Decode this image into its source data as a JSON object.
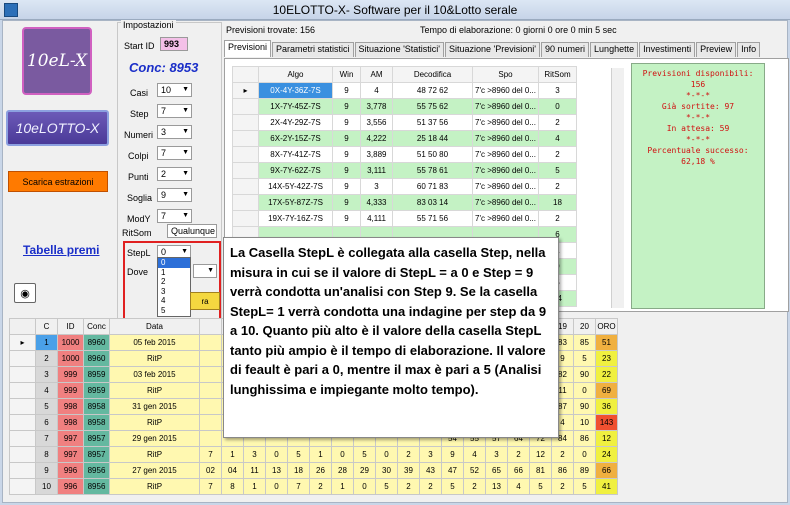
{
  "window": {
    "title": "10ELOTTO-X- Software per il 10&Lotto  serale"
  },
  "logos": {
    "logo_small": "10eL-X",
    "logo_wide": "10eLOTTO-X"
  },
  "left": {
    "download_label": "Scarica estrazioni",
    "prize_link": "Tabella premi"
  },
  "settings": {
    "group_title": "Impostazioni",
    "start_id_label": "Start ID",
    "start_id_value": "993",
    "conc": "Conc: 8953",
    "casi_label": "Casi",
    "casi_value": "10",
    "step_label": "Step",
    "step_value": "7",
    "numeri_label": "Numeri",
    "numeri_value": "3",
    "colpi_label": "Colpi",
    "colpi_value": "7",
    "punti_label": "Punti",
    "punti_value": "2",
    "soglia_label": "Soglia",
    "soglia_value": "9",
    "mody_label": "ModY",
    "mody_value": "7",
    "ritsom_label": "RitSom",
    "ritsom_value": "Qualunque",
    "stepl_label": "StepL",
    "stepl_value": "0",
    "dove_label": "Dove",
    "start_btn": "ra"
  },
  "stepl_options": [
    "0",
    "1",
    "2",
    "3",
    "4",
    "5"
  ],
  "header": {
    "previsioni_trovate": "Previsioni trovate: 156",
    "tempo": "Tempo di elaborazione: 0 giorni 0 ore 0 min 5 sec"
  },
  "tabs": [
    "Previsioni",
    "Parametri statistici",
    "Situazione 'Statistici'",
    "Situazione 'Previsioni'",
    "90 numeri",
    "Lunghette",
    "Investimenti",
    "Preview",
    "Info"
  ],
  "prev_table": {
    "headers": [
      "Algo",
      "Win",
      "AM",
      "Decodifica",
      "Spo",
      "RitSom"
    ],
    "rows": [
      [
        "0X-4Y-36Z-7S",
        "9",
        "4",
        "48 72 62",
        "7'c >8960 del 0...",
        "3"
      ],
      [
        "1X-7Y-45Z-7S",
        "9",
        "3,778",
        "55 75 62",
        "7'c >8960 del 0...",
        "0"
      ],
      [
        "2X-4Y-29Z-7S",
        "9",
        "3,556",
        "51 37 56",
        "7'c >8960 del 0...",
        "2"
      ],
      [
        "6X-2Y-15Z-7S",
        "9",
        "4,222",
        "25 18 44",
        "7'c >8960 del 0...",
        "4"
      ],
      [
        "8X-7Y-41Z-7S",
        "9",
        "3,889",
        "51 50 80",
        "7'c >8960 del 0...",
        "2"
      ],
      [
        "9X-7Y-62Z-7S",
        "9",
        "3,111",
        "55 78 61",
        "7'c >8960 del 0...",
        "5"
      ],
      [
        "14X-5Y-42Z-7S",
        "9",
        "3",
        "60 71 83",
        "7'c >8960 del 0...",
        "2"
      ],
      [
        "17X-5Y-87Z-7S",
        "9",
        "4,333",
        "83 03 14",
        "7'c >8960 del 0...",
        "18"
      ],
      [
        "19X-7Y-16Z-7S",
        "9",
        "4,111",
        "55 71 56",
        "7'c >8960 del 0...",
        "2"
      ],
      [
        "",
        "",
        "",
        "",
        "",
        "6"
      ],
      [
        "",
        "",
        "",
        "",
        "",
        "1"
      ],
      [
        "",
        "",
        "",
        "",
        "",
        "9"
      ],
      [
        "",
        "",
        "",
        "",
        "",
        "5"
      ],
      [
        "",
        "",
        "",
        "",
        "",
        "14"
      ]
    ]
  },
  "info": {
    "l1": "Previsioni disponibili:",
    "l2": "156",
    "sep": "*-*-*",
    "l3": "Già sortite: 97",
    "l4": "In attesa: 59",
    "l5": "Percentuale successo:",
    "l6": "62,18 %"
  },
  "callout": {
    "text": "La Casella StepL è collegata alla casella Step, nella misura in cui se il valore di StepL = a 0 e Step = 9 verrà condotta un'analisi con Step 9. Se la casella StepL= 1 verrà condotta una indagine per step da 9 a 10. Quanto più alto è il valore della casella StepL tanto più ampio è il tempo di elaborazione. Il valore di feault è pari a 0, mentre il max è pari a 5 (Analisi lunghissima e impiegante molto tempo)."
  },
  "draw_table": {
    "headers_left": [
      "C",
      "ID",
      "Conc",
      "Data"
    ],
    "headers_right": [
      "14",
      "15",
      "16",
      "17",
      "18",
      "19",
      "20",
      "ORO"
    ],
    "rows": [
      {
        "c": "1",
        "id": "1000",
        "conc": "8960",
        "data": "05 feb 2015",
        "mid": [
          "",
          "",
          "",
          "",
          "",
          "",
          "",
          "",
          "",
          "",
          ""
        ],
        "right": [
          "67",
          "69",
          "70",
          "75",
          "78",
          "83",
          "85"
        ],
        "oro": "51"
      },
      {
        "c": "2",
        "id": "1000",
        "conc": "8960",
        "data": "RitP",
        "mid": [
          "",
          "",
          "",
          "",
          "",
          "",
          "",
          "",
          "",
          "",
          ""
        ],
        "right": [
          "12",
          "4",
          "5",
          "4",
          "8",
          "9",
          "5"
        ],
        "oro": "23"
      },
      {
        "c": "3",
        "id": "999",
        "conc": "8959",
        "data": "03 feb 2015",
        "mid": [
          "",
          "",
          "",
          "",
          "",
          "",
          "",
          "",
          "",
          "",
          ""
        ],
        "right": [
          "52",
          "54",
          "55",
          "59",
          "68",
          "82",
          "90"
        ],
        "oro": "22"
      },
      {
        "c": "4",
        "id": "999",
        "conc": "8959",
        "data": "RitP",
        "mid": [
          "",
          "",
          "",
          "",
          "",
          "",
          "",
          "",
          "",
          "",
          ""
        ],
        "right": [
          "0",
          "1",
          "1",
          "3",
          "9",
          "11",
          "0"
        ],
        "oro": "69"
      },
      {
        "c": "5",
        "id": "998",
        "conc": "8958",
        "data": "31 gen 2015",
        "mid": [
          "",
          "",
          "",
          "",
          "",
          "",
          "",
          "",
          "",
          "",
          ""
        ],
        "right": [
          "52",
          "71",
          "73",
          "80",
          "83",
          "87",
          "90"
        ],
        "oro": "36"
      },
      {
        "c": "6",
        "id": "998",
        "conc": "8958",
        "data": "RitP",
        "mid": [
          "",
          "",
          "",
          "",
          "",
          "",
          "",
          "",
          "",
          "",
          ""
        ],
        "right": [
          "1",
          "3",
          "2",
          "4",
          "0",
          "4",
          "10"
        ],
        "oro": "143"
      },
      {
        "c": "7",
        "id": "997",
        "conc": "8957",
        "data": "29 gen 2015",
        "mid": [
          "",
          "",
          "",
          "",
          "",
          "",
          "",
          "",
          "",
          "",
          ""
        ],
        "right": [
          "54",
          "55",
          "57",
          "64",
          "72",
          "84",
          "86"
        ],
        "oro": "12"
      },
      {
        "c": "8",
        "id": "997",
        "conc": "8957",
        "data": "RitP",
        "mid": [
          "7",
          "1",
          "3",
          "0",
          "5",
          "1",
          "0",
          "5",
          "0",
          "2",
          "3"
        ],
        "right": [
          "9",
          "4",
          "3",
          "2",
          "12",
          "2",
          "0"
        ],
        "oro": "24"
      },
      {
        "c": "9",
        "id": "996",
        "conc": "8956",
        "data": "27 gen 2015",
        "mid": [
          "02",
          "04",
          "11",
          "13",
          "18",
          "26",
          "28",
          "29",
          "30",
          "39",
          "43"
        ],
        "right": [
          "47",
          "52",
          "65",
          "66",
          "81",
          "86",
          "89"
        ],
        "oro": "66"
      },
      {
        "c": "10",
        "id": "996",
        "conc": "8956",
        "data": "RitP",
        "mid": [
          "7",
          "8",
          "1",
          "0",
          "7",
          "2",
          "1",
          "0",
          "5",
          "2",
          "2"
        ],
        "right": [
          "5",
          "2",
          "13",
          "4",
          "5",
          "2",
          "5"
        ],
        "oro": "41"
      }
    ]
  }
}
